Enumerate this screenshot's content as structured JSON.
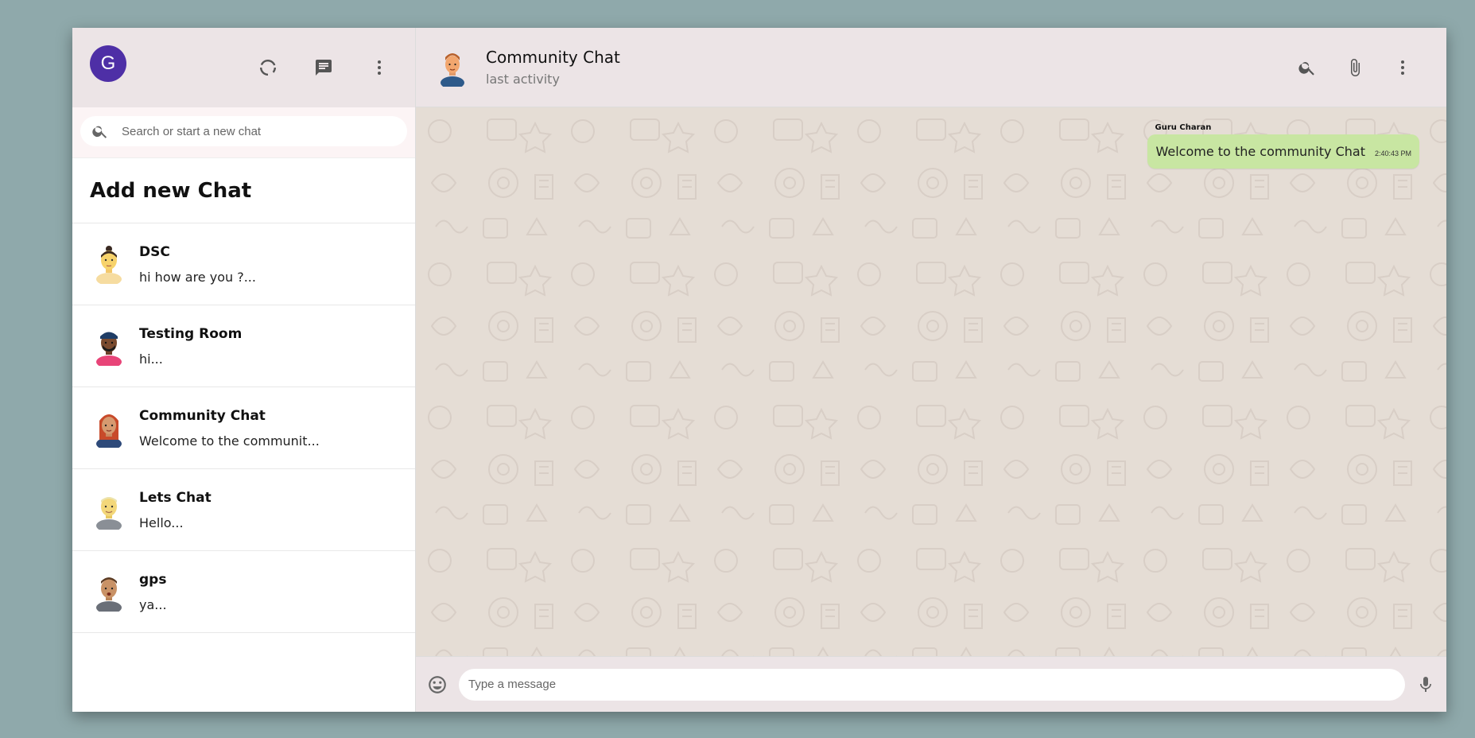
{
  "sidebar": {
    "user_initial": "G",
    "search_placeholder": "Search or start a new chat",
    "add_chat_label": "Add new Chat",
    "chats": [
      {
        "name": "DSC",
        "last": "hi how are you ?..."
      },
      {
        "name": "Testing Room",
        "last": "hi..."
      },
      {
        "name": "Community Chat",
        "last": "Welcome to the communit..."
      },
      {
        "name": "Lets Chat",
        "last": "Hello..."
      },
      {
        "name": "gps",
        "last": "ya..."
      }
    ]
  },
  "header": {
    "title": "Community Chat",
    "subtitle": "last activity"
  },
  "messages": [
    {
      "sender": "Guru Charan",
      "text": "Welcome to the community Chat",
      "time": "2:40:43 PM"
    }
  ],
  "footer": {
    "placeholder": "Type a message"
  },
  "colors": {
    "accent": "#4e2fa6",
    "header_bg": "#ece4e6",
    "bubble": "#c8e6a2",
    "page_bg": "#8fa9ab"
  },
  "icons": [
    "status-icon",
    "chat-icon",
    "more-vert-icon",
    "search-icon",
    "attach-icon",
    "emoji-icon",
    "mic-icon"
  ]
}
